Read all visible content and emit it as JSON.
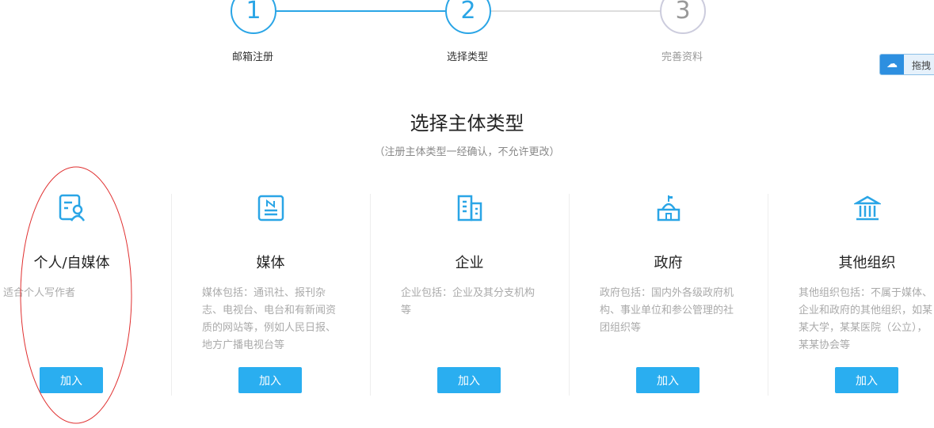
{
  "steps": [
    {
      "num": "1",
      "label": "邮箱注册"
    },
    {
      "num": "2",
      "label": "选择类型"
    },
    {
      "num": "3",
      "label": "完善资料"
    }
  ],
  "title": "选择主体类型",
  "subtitle": "（注册主体类型一经确认，不允许更改）",
  "drag_widget": {
    "label": "拖拽"
  },
  "colors": {
    "accent": "#2aaef0",
    "annotation": "#e03030"
  },
  "types": [
    {
      "name": "个人/自媒体",
      "desc": "适合个人写作者",
      "button": "加入",
      "icon": "person-card-icon"
    },
    {
      "name": "媒体",
      "desc": "媒体包括：通讯社、报刊杂志、电视台、电台和有新闻资质的网站等，例如人民日报、地方广播电视台等",
      "button": "加入",
      "icon": "newspaper-icon"
    },
    {
      "name": "企业",
      "desc": "企业包括：企业及其分支机构等",
      "button": "加入",
      "icon": "building-icon"
    },
    {
      "name": "政府",
      "desc": "政府包括：国内外各级政府机构、事业单位和参公管理的社团组织等",
      "button": "加入",
      "icon": "government-icon"
    },
    {
      "name": "其他组织",
      "desc": "其他组织包括：不属于媒体、企业和政府的其他组织，如某某大学，某某医院（公立），某某协会等",
      "button": "加入",
      "icon": "institution-icon"
    }
  ]
}
